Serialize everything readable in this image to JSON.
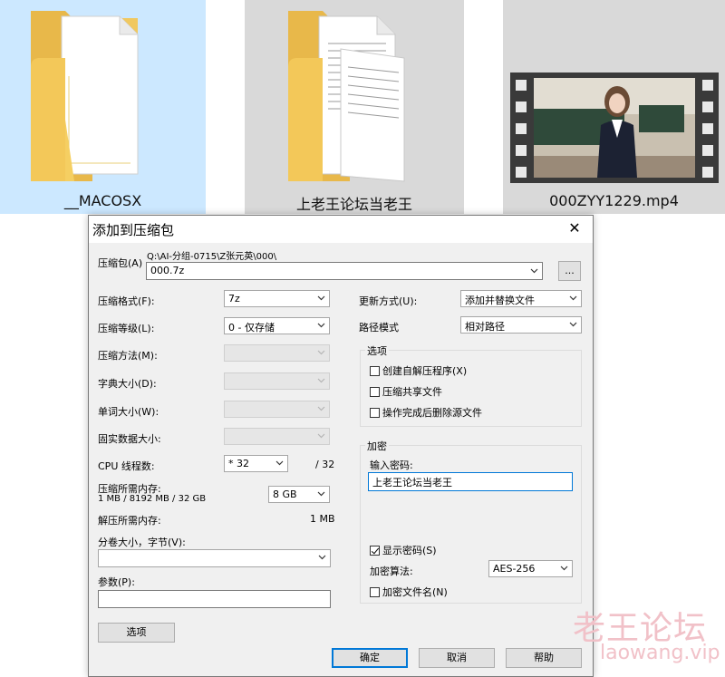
{
  "explorer": {
    "items": [
      {
        "name": "__MACOSX",
        "icon": "folder-icon",
        "selected": true
      },
      {
        "name": "上老王论坛当老王",
        "icon": "folder-icon",
        "selected": false
      },
      {
        "name": "000ZYY1229.mp4",
        "icon": "video-thumbnail-icon",
        "selected": false
      }
    ]
  },
  "dialog": {
    "title": "添加到压缩包",
    "close_glyph": "✕",
    "archive": {
      "label": "压缩包(A)",
      "path": "Q:\\AI-分组-0715\\Z张元英\\000\\",
      "name": "000.7z",
      "browse_label": "..."
    },
    "left": {
      "format": {
        "label": "压缩格式(F):",
        "value": "7z"
      },
      "level": {
        "label": "压缩等级(L):",
        "value": "0 - 仅存储"
      },
      "method": {
        "label": "压缩方法(M):",
        "value": ""
      },
      "dict": {
        "label": "字典大小(D):",
        "value": ""
      },
      "word": {
        "label": "单词大小(W):",
        "value": ""
      },
      "solid": {
        "label": "固实数据大小:",
        "value": ""
      },
      "cpu": {
        "label": "CPU 线程数:",
        "value": "* 32",
        "max": "/ 32"
      },
      "mem_compress": {
        "label": "压缩所需内存:",
        "detail": "1 MB / 8192 MB / 32 GB",
        "value": "8 GB"
      },
      "mem_decompress": {
        "label": "解压所需内存:",
        "value": "1 MB"
      },
      "volume": {
        "label": "分卷大小，字节(V):",
        "value": ""
      },
      "params": {
        "label": "参数(P):",
        "value": ""
      },
      "options_button": "选项"
    },
    "right": {
      "update": {
        "label": "更新方式(U):",
        "value": "添加并替换文件"
      },
      "path_mode": {
        "label": "路径模式",
        "value": "相对路径"
      },
      "options_group": {
        "title": "选项",
        "items": [
          {
            "label": "创建自解压程序(X)",
            "checked": false
          },
          {
            "label": "压缩共享文件",
            "checked": false
          },
          {
            "label": "操作完成后删除源文件",
            "checked": false
          }
        ]
      },
      "encryption": {
        "title": "加密",
        "password_label": "输入密码:",
        "password_value": "上老王论坛当老王",
        "show_password": {
          "label": "显示密码(S)",
          "checked": true
        },
        "method_label": "加密算法:",
        "method_value": "AES-256",
        "encrypt_names": {
          "label": "加密文件名(N)",
          "checked": false
        }
      }
    },
    "buttons": {
      "ok": "确定",
      "cancel": "取消",
      "help": "帮助"
    }
  },
  "watermark": {
    "line1": "老王论坛",
    "line2": "laowang.vip"
  }
}
